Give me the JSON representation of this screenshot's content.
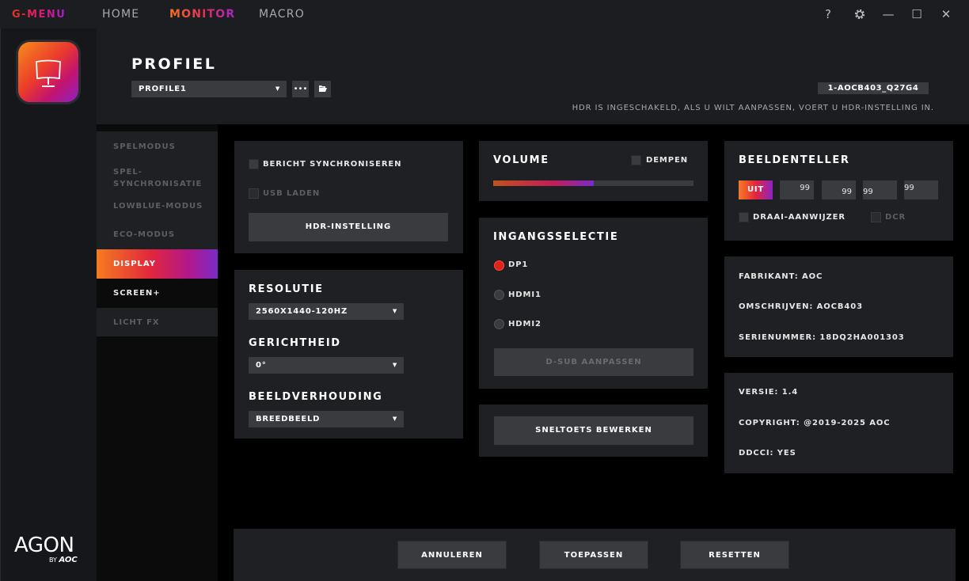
{
  "app": {
    "brand": "G-MENU"
  },
  "nav": {
    "home": "HOME",
    "monitor": "MONITOR",
    "macro": "MACRO"
  },
  "window": {
    "help": "?",
    "minimize": "—",
    "maximize": "☐",
    "close": "✕"
  },
  "logo": {
    "name": "AGON",
    "by": "BY",
    "maker": "AOC"
  },
  "header": {
    "title": "PROFIEL",
    "profile_value": "PROFILE1",
    "model": "1-AOCB403_Q27G4",
    "hdr_note": "HDR IS INGESCHAKELD, ALS U WILT AANPASSEN, VOERT U HDR-INSTELLING IN."
  },
  "sidebar": {
    "items": [
      {
        "label": "SPELMODUS"
      },
      {
        "label": "SPEL-\nSYNCHRONISATIE"
      },
      {
        "label": "LOWBLUE-MODUS"
      },
      {
        "label": "ECO-MODUS"
      },
      {
        "label": "DISPLAY"
      },
      {
        "label": "SCREEN+"
      },
      {
        "label": "LICHT FX"
      }
    ]
  },
  "sync_panel": {
    "bericht_sync": "BERICHT SYNCHRONISEREN",
    "usb_laden": "USB LADEN",
    "hdr_button": "HDR-INSTELLING"
  },
  "display_panel": {
    "resolutie_title": "RESOLUTIE",
    "resolutie_value": "2560X1440-120HZ",
    "gerichtheid_title": "GERICHTHEID",
    "gerichtheid_value": "0°",
    "beeldverhouding_title": "BEELDVERHOUDING",
    "beeldverhouding_value": "BREEDBEELD"
  },
  "volume_panel": {
    "title": "VOLUME",
    "mute_label": "DEMPEN",
    "level": 0.5
  },
  "input_panel": {
    "title": "INGANGSSELECTIE",
    "options": [
      "DP1",
      "HDMI1",
      "HDMI2"
    ],
    "selected": "DP1",
    "dsub_button": "D-SUB AANPASSEN"
  },
  "hotkey_panel": {
    "button": "SNELTOETS BEWERKEN"
  },
  "frame_counter": {
    "title": "BEELDENTELLER",
    "toggle": "UIT",
    "values": [
      "99",
      "99",
      "99",
      "99"
    ],
    "draai": "DRAAI-AANWIJZER",
    "dcr": "DCR"
  },
  "info": {
    "fabrikant": "FABRIKANT: AOC",
    "omschrijven": "OMSCHRIJVEN: AOCB403",
    "serienummer": "SERIENUMMER: 18DQ2HA001303"
  },
  "about": {
    "versie": "VERSIE: 1.4",
    "copyright": "COPYRIGHT: @2019-2025 AOC",
    "ddcci": "DDCCI: YES"
  },
  "footer": {
    "annuleren": "ANNULEREN",
    "toepassen": "TOEPASSEN",
    "resetten": "RESETTEN"
  },
  "colors": {
    "accent_orange": "#f47321",
    "accent_red": "#e0221c",
    "accent_purple": "#8d22c2",
    "panel": "#1f2023",
    "control": "#3a3b3f"
  }
}
